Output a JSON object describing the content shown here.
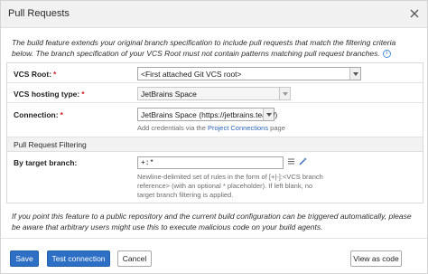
{
  "dialog": {
    "title": "Pull Requests",
    "close_icon": "close-icon"
  },
  "intro": {
    "text": "The build feature extends your original branch specification to include pull requests that match the filtering criteria below. The branch specification of your VCS Root must not contain patterns matching pull request branches.",
    "info_icon": "i"
  },
  "fields": {
    "vcs_root": {
      "label": "VCS Root:",
      "required_mark": "*",
      "value": "<First attached Git VCS root>"
    },
    "vcs_hosting": {
      "label": "VCS hosting type:",
      "required_mark": "*",
      "value": "JetBrains Space"
    },
    "connection": {
      "label": "Connection:",
      "required_mark": "*",
      "value": "JetBrains Space (https://jetbrains.team/)",
      "hint_prefix": "Add credentials via the ",
      "hint_link": "Project Connections",
      "hint_suffix": " page"
    }
  },
  "filtering": {
    "section_title": "Pull Request Filtering",
    "target_branch": {
      "label": "By target branch:",
      "value": "+:*",
      "hint": "Newline-delimited set of rules in the form of [+|-]:<VCS branch reference> (with an optional * placeholder). If left blank, no target branch filtering is applied."
    }
  },
  "warning": {
    "text": "If you point this feature to a public repository and the current build configuration can be triggered automatically, please be aware that arbitrary users might use this to execute malicious code on your build agents."
  },
  "buttons": {
    "save": "Save",
    "test_connection": "Test connection",
    "cancel": "Cancel",
    "view_as_code": "View as code"
  },
  "colors": {
    "primary": "#2d6fc4",
    "required": "#d21f1f",
    "link": "#2a64b8"
  }
}
